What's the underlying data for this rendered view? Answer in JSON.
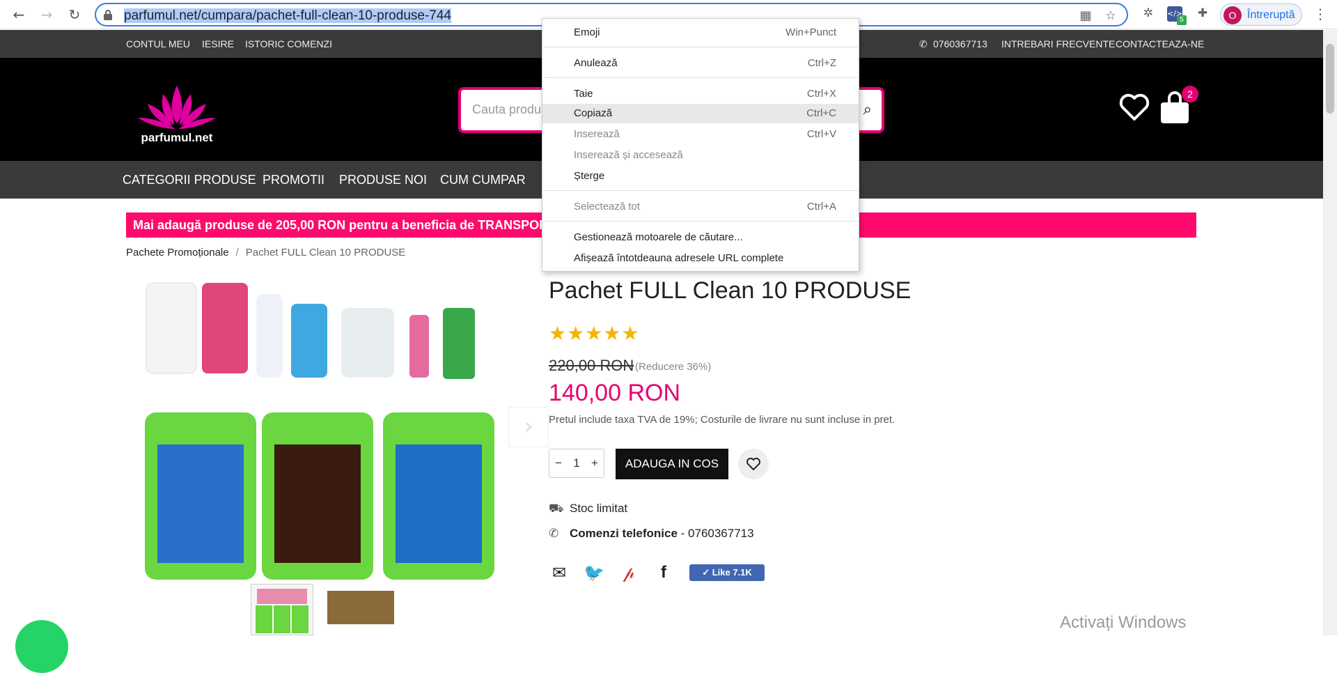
{
  "browser": {
    "url_highlighted": "parfumul.net/cumpara/pachet-full-clean-10-produse-744",
    "profile_initial": "O",
    "profile_label": "Întreruptă",
    "ext_badge": "5"
  },
  "topbar": {
    "left": [
      "CONTUL MEU",
      "IESIRE",
      "ISTORIC COMENZI"
    ],
    "phone": "0760367713",
    "faq": "INTREBARI FRECVENTE",
    "contact": "CONTACTEAZA-NE"
  },
  "header": {
    "logo_text": "parfumul.net",
    "search_placeholder": "Cauta produs",
    "cart_count": "2"
  },
  "mainnav": [
    "CATEGORII PRODUSE",
    "PROMOTII",
    "PRODUSE NOI",
    "CUM CUMPAR"
  ],
  "promo_banner": "Mai adaugă produse de 205,00 RON pentru a beneficia de TRANSPORT GRATUIT",
  "breadcrumb": {
    "parent": "Pachete Promoționale",
    "current": "Pachet FULL Clean 10 PRODUSE"
  },
  "product": {
    "title": "Pachet FULL Clean 10 PRODUSE",
    "stars": "★★★★★",
    "old_price": "220,00 RON",
    "discount": "(Reducere 36%)",
    "price": "140,00 RON",
    "vat_note": "Pretul include taxa TVA de 19%;   Costurile de livrare nu sunt incluse in pret.",
    "qty": "1",
    "add_to_cart": "ADAUGA IN COS",
    "stock": "Stoc limitat",
    "phone_label": "Comenzi telefonice",
    "phone_value": " - 0760367713",
    "fb_like": "Like 7.1K"
  },
  "context_menu": [
    {
      "label": "Emoji",
      "shortcut": "Win+Punct",
      "disabled": false
    },
    {
      "label": "Anulează",
      "shortcut": "Ctrl+Z",
      "disabled": false
    },
    {
      "label": "Taie",
      "shortcut": "Ctrl+X",
      "disabled": false
    },
    {
      "label": "Copiază",
      "shortcut": "Ctrl+C",
      "disabled": false
    },
    {
      "label": "Inserează",
      "shortcut": "Ctrl+V",
      "disabled": true
    },
    {
      "label": "Inserează și accesează",
      "shortcut": "",
      "disabled": true
    },
    {
      "label": "Șterge",
      "shortcut": "",
      "disabled": false
    },
    {
      "label": "Selectează tot",
      "shortcut": "Ctrl+A",
      "disabled": true
    },
    {
      "label": "Gestionează motoarele de căutare...",
      "shortcut": "",
      "disabled": false
    },
    {
      "label": "Afișează întotdeauna adresele URL complete",
      "shortcut": "",
      "disabled": false
    }
  ],
  "watermark": "Activați Windows",
  "colors": {
    "brand_pink": "#e40072",
    "banner_pink": "#ff0a6c",
    "stars": "#f5b301"
  }
}
